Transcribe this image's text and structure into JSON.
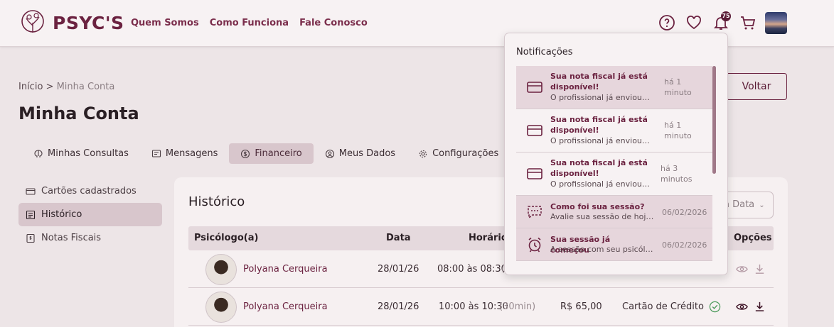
{
  "brand": {
    "name": "PSYC'S"
  },
  "nav": [
    {
      "label": "Quem Somos"
    },
    {
      "label": "Como Funciona"
    },
    {
      "label": "Fale Conosco"
    }
  ],
  "header_icons": {
    "help": "help-circle-icon",
    "favorites": "heart-icon",
    "notifications": "bell-icon",
    "notifications_count": "75",
    "cart": "cart-icon"
  },
  "breadcrumb": {
    "home": "Início",
    "separator": ">",
    "current": "Minha Conta"
  },
  "page_title": "Minha Conta",
  "back_button": "Voltar",
  "tabs": [
    {
      "label": "Minhas Consultas",
      "icon": "brain-icon"
    },
    {
      "label": "Mensagens",
      "icon": "message-icon"
    },
    {
      "label": "Financeiro",
      "icon": "dollar-icon",
      "active": true
    },
    {
      "label": "Meus Dados",
      "icon": "user-icon"
    },
    {
      "label": "Configurações",
      "icon": "gear-icon"
    }
  ],
  "sidebar": [
    {
      "label": "Cartões cadastrados",
      "icon": "card-icon"
    },
    {
      "label": "Histórico",
      "icon": "list-icon",
      "active": true
    },
    {
      "label": "Notas Fiscais",
      "icon": "invoice-icon"
    }
  ],
  "history": {
    "title": "Histórico",
    "filter_label": "a Data",
    "columns": {
      "psychologist": "Psicólogo(a)",
      "date": "Data",
      "time": "Horário",
      "options": "Opções"
    },
    "rows": [
      {
        "name": "Polyana Cerqueira",
        "date": "28/01/26",
        "time": "08:00 às 08:30",
        "duration": "(",
        "value": "",
        "payment": ""
      },
      {
        "name": "Polyana Cerqueira",
        "date": "28/01/26",
        "time": "10:00 às 10:30",
        "duration": "(30min)",
        "value": "R$ 65,00",
        "payment": "Cartão de Crédito"
      }
    ]
  },
  "notifications": {
    "title": "Notificações",
    "items": [
      {
        "title": "Sua nota fiscal já está disponível!",
        "desc": "O profissional já enviou a nota fiscal",
        "time": "há 1 minuto",
        "icon": "card-icon",
        "unread": true
      },
      {
        "title": "Sua nota fiscal já está disponível!",
        "desc": "O profissional já enviou a nota fiscal",
        "time": "há 1 minuto",
        "icon": "card-icon",
        "unread": false
      },
      {
        "title": "Sua nota fiscal já está disponível!",
        "desc": "O profissional já enviou a nota fiscal",
        "time": "há 3 minutos",
        "icon": "card-icon",
        "unread": false
      },
      {
        "title": "Como foi sua sessão?",
        "desc": "Avalie sua sessão de hoje com o profissional",
        "time": "06/02/2026",
        "icon": "chat-dots-icon",
        "unread": true
      },
      {
        "title": "Sua sessão já começou",
        "desc": "A sessão com seu psicólogo já começou",
        "time": "06/02/2026",
        "icon": "alarm-icon",
        "unread": true
      }
    ]
  },
  "colors": {
    "brand": "#6b2240",
    "background": "#ede5e7",
    "active_tab": "#d8c6cc",
    "unread": "#e6d6dc"
  }
}
